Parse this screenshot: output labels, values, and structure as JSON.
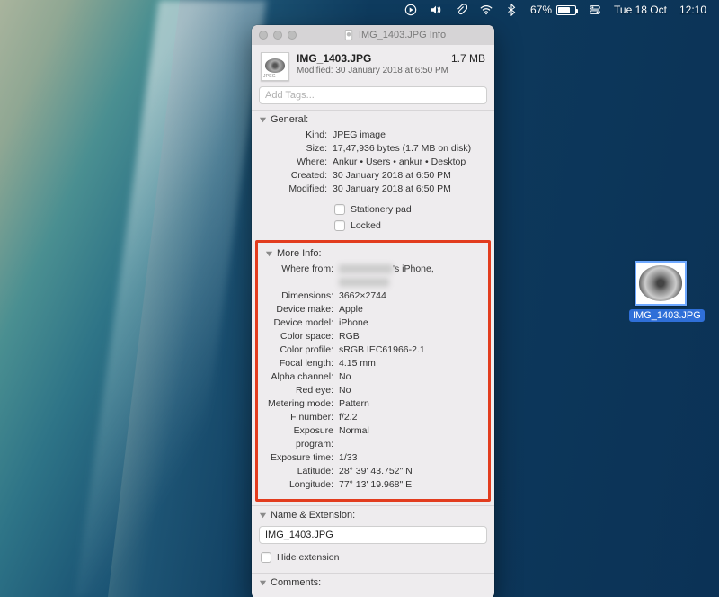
{
  "menubar": {
    "battery_pct": "67%",
    "date": "Tue 18 Oct",
    "time": "12:10"
  },
  "desktop_file": {
    "label": "IMG_1403.JPG"
  },
  "window": {
    "title": "IMG_1403.JPG Info",
    "header": {
      "filename": "IMG_1403.JPG",
      "size": "1.7 MB",
      "modified_line": "Modified: 30 January 2018 at 6:50 PM"
    },
    "tags_placeholder": "Add Tags...",
    "general": {
      "heading": "General:",
      "kind": {
        "k": "Kind:",
        "v": "JPEG image"
      },
      "size": {
        "k": "Size:",
        "v": "17,47,936 bytes (1.7 MB on disk)"
      },
      "where": {
        "k": "Where:",
        "v": "Ankur • Users • ankur • Desktop"
      },
      "created": {
        "k": "Created:",
        "v": "30 January 2018 at 6:50 PM"
      },
      "modified": {
        "k": "Modified:",
        "v": "30 January 2018 at 6:50 PM"
      },
      "stationery": "Stationery pad",
      "locked": "Locked"
    },
    "more_info": {
      "heading": "More Info:",
      "where_from_k": "Where from:",
      "where_from_suffix": "'s iPhone,",
      "dimensions": {
        "k": "Dimensions:",
        "v": "3662×2744"
      },
      "device_make": {
        "k": "Device make:",
        "v": "Apple"
      },
      "device_model": {
        "k": "Device model:",
        "v": "iPhone"
      },
      "color_space": {
        "k": "Color space:",
        "v": "RGB"
      },
      "color_profile": {
        "k": "Color profile:",
        "v": "sRGB IEC61966-2.1"
      },
      "focal_length": {
        "k": "Focal length:",
        "v": "4.15 mm"
      },
      "alpha_channel": {
        "k": "Alpha channel:",
        "v": "No"
      },
      "red_eye": {
        "k": "Red eye:",
        "v": "No"
      },
      "metering_mode": {
        "k": "Metering mode:",
        "v": "Pattern"
      },
      "f_number": {
        "k": "F number:",
        "v": "f/2.2"
      },
      "exposure_program": {
        "k": "Exposure program:",
        "v": "Normal"
      },
      "exposure_time": {
        "k": "Exposure time:",
        "v": "1/33"
      },
      "latitude": {
        "k": "Latitude:",
        "v": "28° 39' 43.752\" N"
      },
      "longitude": {
        "k": "Longitude:",
        "v": "77° 13' 19.968\" E"
      }
    },
    "name_ext": {
      "heading": "Name & Extension:",
      "value": "IMG_1403.JPG",
      "hide_extension": "Hide extension"
    },
    "comments": {
      "heading": "Comments:"
    }
  }
}
